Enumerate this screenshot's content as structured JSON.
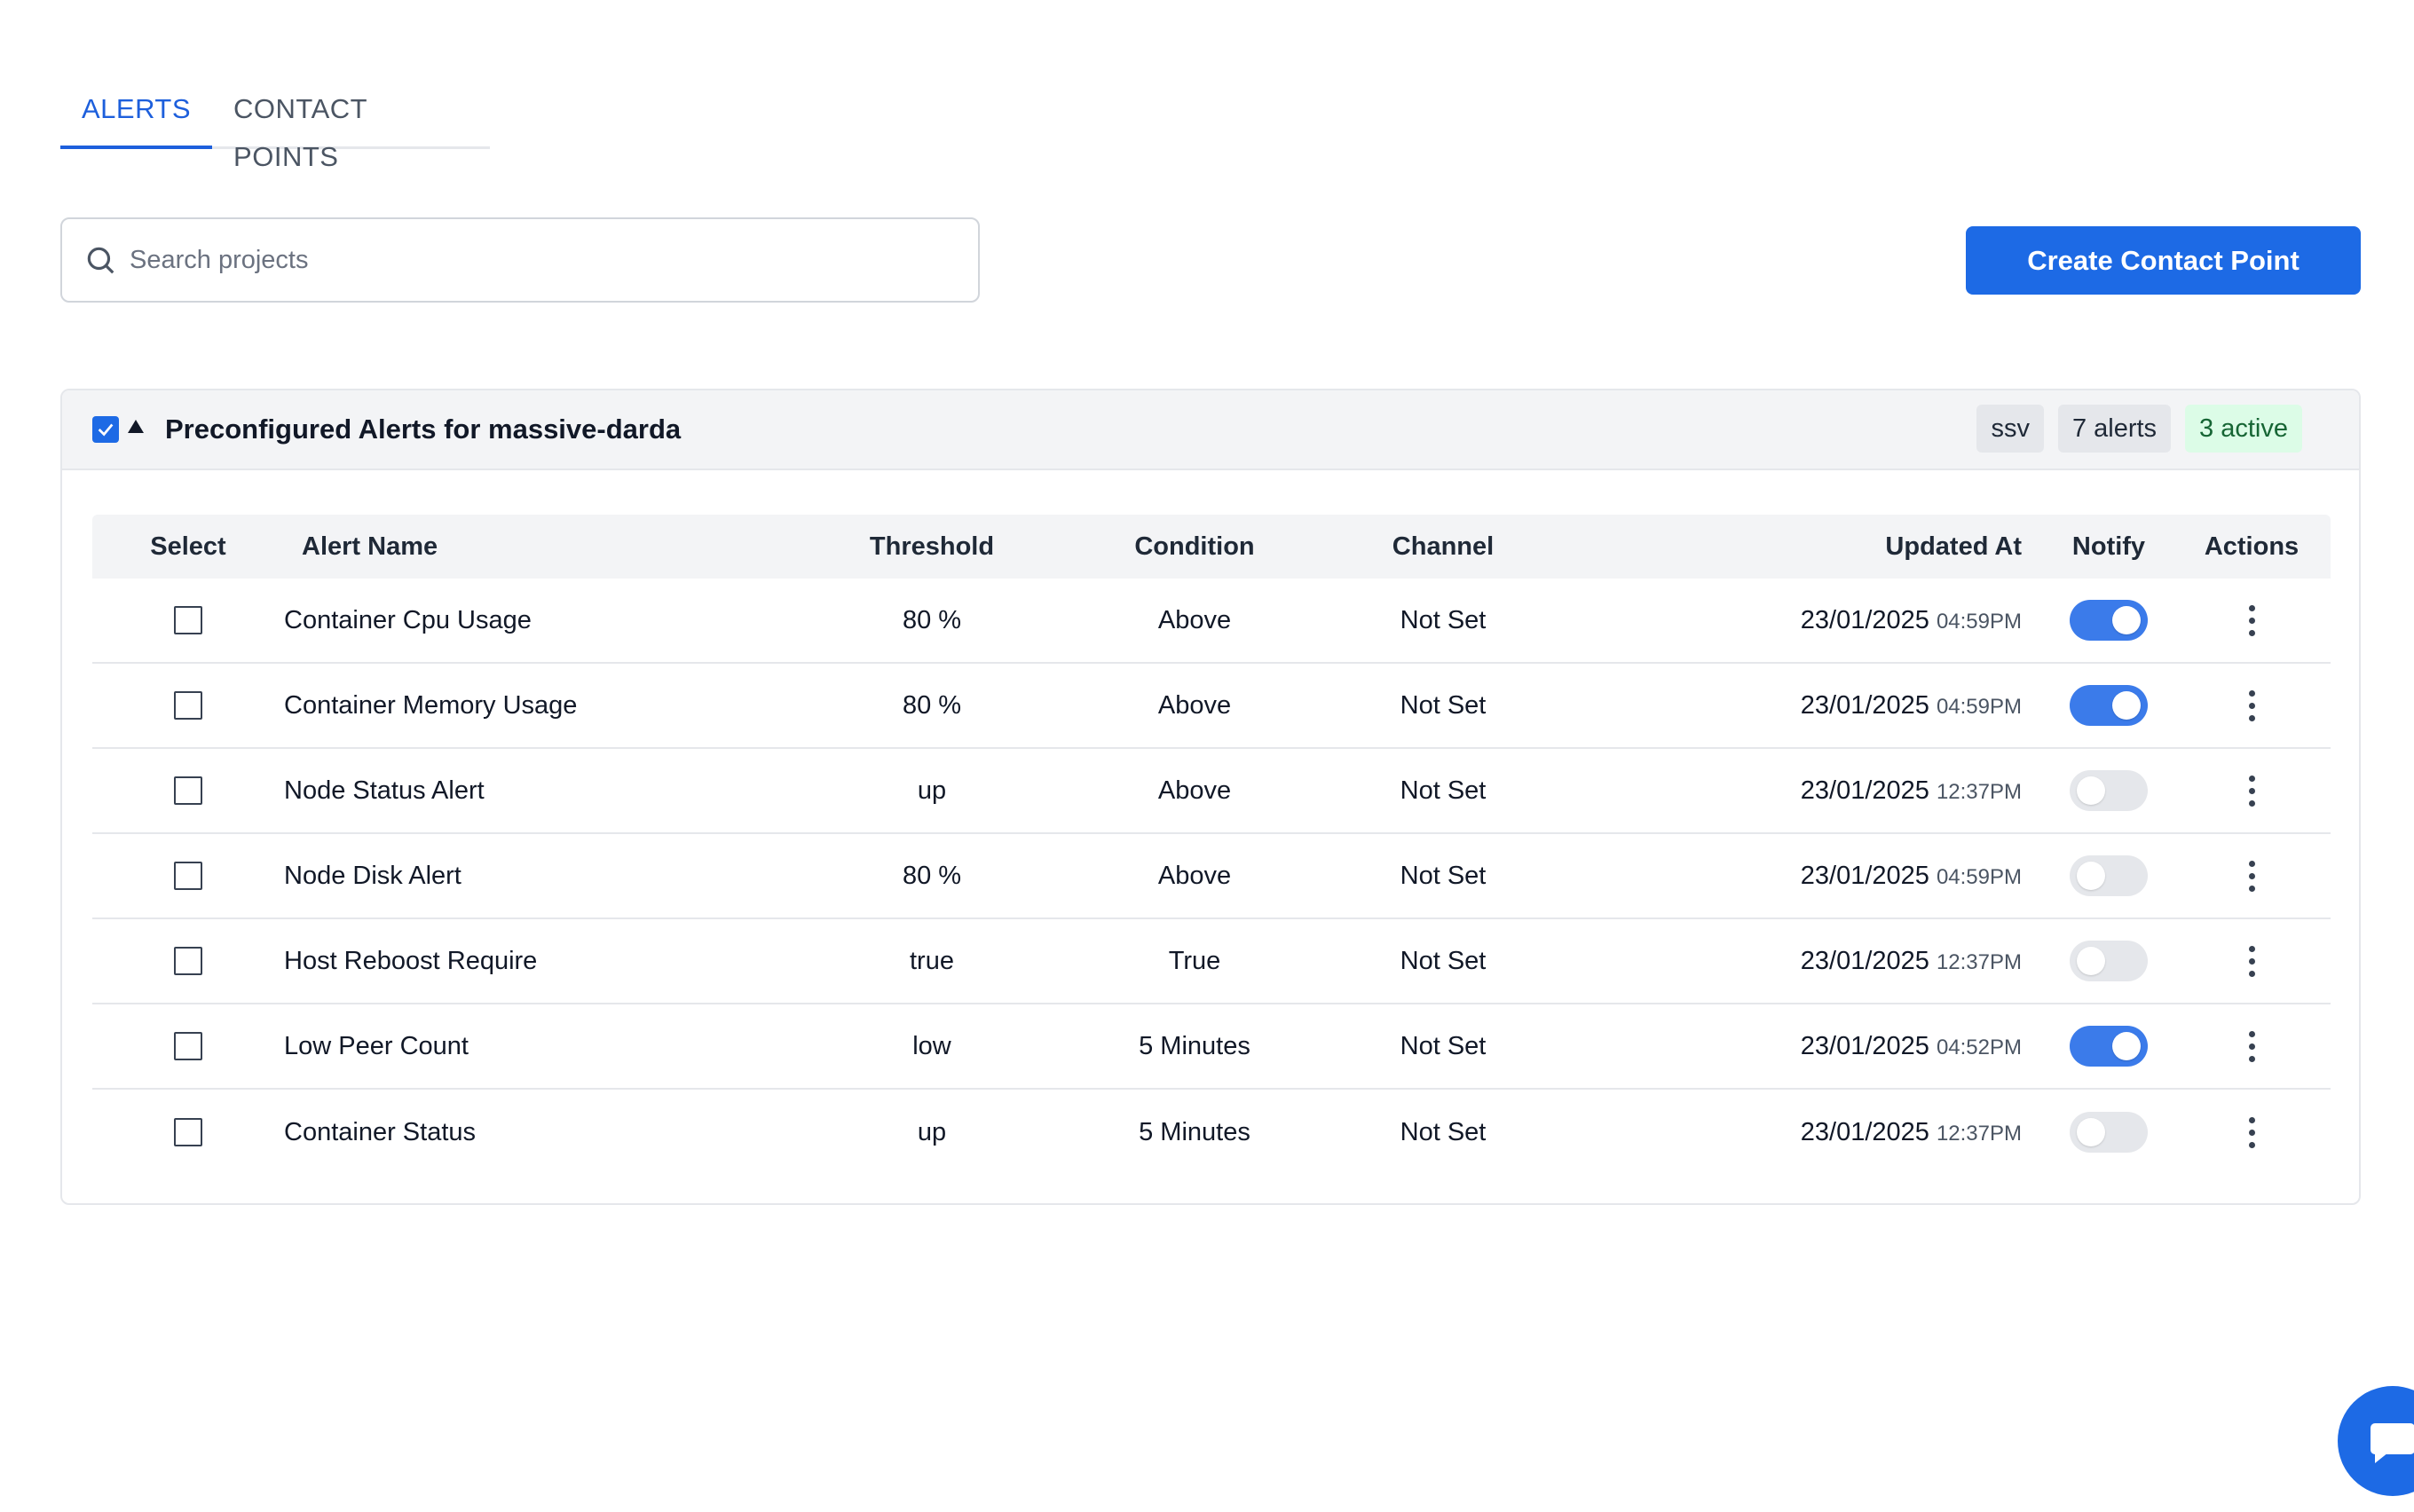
{
  "tabs": [
    {
      "label": "ALERTS",
      "active": true
    },
    {
      "label": "CONTACT POINTS",
      "active": false
    }
  ],
  "search": {
    "placeholder": "Search projects",
    "icon": "search-icon"
  },
  "create_button": {
    "label": "Create Contact Point"
  },
  "group": {
    "title": "Preconfigured Alerts for massive-darda",
    "badges": {
      "tag": "ssv",
      "count": "7 alerts",
      "active": "3 active"
    }
  },
  "table": {
    "headers": {
      "select": "Select",
      "name": "Alert Name",
      "threshold": "Threshold",
      "condition": "Condition",
      "channel": "Channel",
      "updated": "Updated At",
      "notify": "Notify",
      "actions": "Actions"
    },
    "rows": [
      {
        "name": "Container Cpu Usage",
        "threshold": "80 %",
        "condition": "Above",
        "channel": "Not Set",
        "date": "23/01/2025",
        "time": "04:59PM",
        "notify": true
      },
      {
        "name": "Container Memory Usage",
        "threshold": "80 %",
        "condition": "Above",
        "channel": "Not Set",
        "date": "23/01/2025",
        "time": "04:59PM",
        "notify": true
      },
      {
        "name": "Node Status Alert",
        "threshold": "up",
        "condition": "Above",
        "channel": "Not Set",
        "date": "23/01/2025",
        "time": "12:37PM",
        "notify": false
      },
      {
        "name": "Node Disk Alert",
        "threshold": "80 %",
        "condition": "Above",
        "channel": "Not Set",
        "date": "23/01/2025",
        "time": "04:59PM",
        "notify": false
      },
      {
        "name": "Host Reboost Require",
        "threshold": "true",
        "condition": "True",
        "channel": "Not Set",
        "date": "23/01/2025",
        "time": "12:37PM",
        "notify": false
      },
      {
        "name": "Low Peer Count",
        "threshold": "low",
        "condition": "5 Minutes",
        "channel": "Not Set",
        "date": "23/01/2025",
        "time": "04:52PM",
        "notify": true
      },
      {
        "name": "Container Status",
        "threshold": "up",
        "condition": "5 Minutes",
        "channel": "Not Set",
        "date": "23/01/2025",
        "time": "12:37PM",
        "notify": false
      }
    ]
  },
  "colors": {
    "accent": "#1d6ae5",
    "active_badge_bg": "#dcfce7",
    "active_badge_text": "#166534"
  }
}
